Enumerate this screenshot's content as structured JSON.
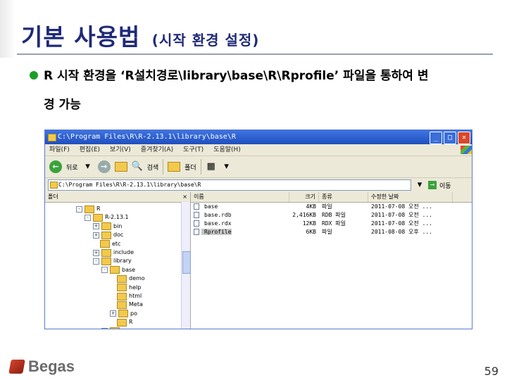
{
  "slide": {
    "title": "기본 사용법",
    "subtitle": "(시작 환경 설정)",
    "bullet": "R 시작 환경을 ‘R설치경로\\library\\base\\R\\Rprofile’ 파일을 통하여 변",
    "bullet_cont": "경 가능",
    "page_number": "59",
    "logo": "Begas"
  },
  "explorer": {
    "title": "C:\\Program Files\\R\\R-2.13.1\\library\\base\\R",
    "menu": [
      "파일(F)",
      "편집(E)",
      "보기(V)",
      "즐겨찾기(A)",
      "도구(T)",
      "도움말(H)"
    ],
    "toolbar": {
      "back": "뒤로",
      "search": "검색",
      "folders": "폴더"
    },
    "address_value": "C:\\Program Files\\R\\R-2.13.1\\library\\base\\R",
    "go_label": "이동",
    "tree_header": "폴더",
    "tree": [
      {
        "label": "R",
        "depth": 0,
        "expander": "-"
      },
      {
        "label": "R-2.13.1",
        "depth": 1,
        "expander": "-"
      },
      {
        "label": "bin",
        "depth": 2,
        "expander": "+"
      },
      {
        "label": "doc",
        "depth": 2,
        "expander": "+"
      },
      {
        "label": "etc",
        "depth": 2,
        "expander": ""
      },
      {
        "label": "include",
        "depth": 2,
        "expander": "+"
      },
      {
        "label": "library",
        "depth": 2,
        "expander": "-"
      },
      {
        "label": "base",
        "depth": 3,
        "expander": "-"
      },
      {
        "label": "demo",
        "depth": 4,
        "expander": ""
      },
      {
        "label": "help",
        "depth": 4,
        "expander": ""
      },
      {
        "label": "html",
        "depth": 4,
        "expander": ""
      },
      {
        "label": "Meta",
        "depth": 4,
        "expander": ""
      },
      {
        "label": "po",
        "depth": 4,
        "expander": "+"
      },
      {
        "label": "R",
        "depth": 4,
        "expander": ""
      },
      {
        "label": "boot",
        "depth": 3,
        "expander": "+"
      }
    ],
    "columns": [
      "이름",
      "크기",
      "종류",
      "수정한 날짜"
    ],
    "files": [
      {
        "name": "base",
        "size": "4KB",
        "type": "파일",
        "date": "2011-07-08 오전 ..."
      },
      {
        "name": "base.rdb",
        "size": "2,416KB",
        "type": "RDB 파일",
        "date": "2011-07-08 오전 ..."
      },
      {
        "name": "base.rdx",
        "size": "12KB",
        "type": "RDX 파일",
        "date": "2011-07-08 오전 ..."
      },
      {
        "name": "Rprofile",
        "size": "6KB",
        "type": "파일",
        "date": "2011-08-08 오후 ..."
      }
    ]
  }
}
